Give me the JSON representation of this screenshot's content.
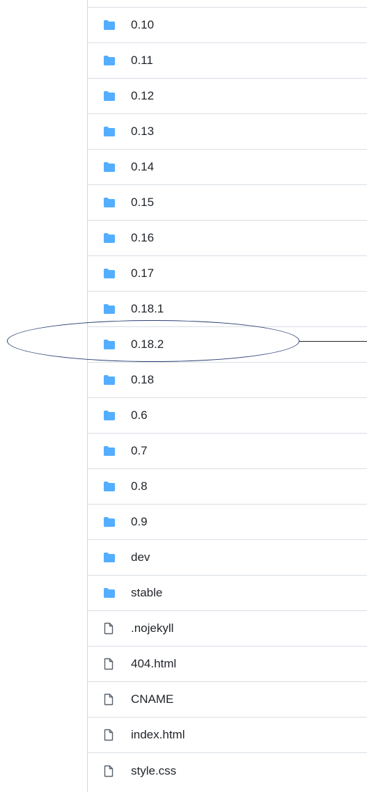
{
  "file_list": {
    "items": [
      {
        "name": "0.10",
        "type": "folder",
        "icon": "folder-icon"
      },
      {
        "name": "0.11",
        "type": "folder",
        "icon": "folder-icon"
      },
      {
        "name": "0.12",
        "type": "folder",
        "icon": "folder-icon"
      },
      {
        "name": "0.13",
        "type": "folder",
        "icon": "folder-icon"
      },
      {
        "name": "0.14",
        "type": "folder",
        "icon": "folder-icon"
      },
      {
        "name": "0.15",
        "type": "folder",
        "icon": "folder-icon"
      },
      {
        "name": "0.16",
        "type": "folder",
        "icon": "folder-icon"
      },
      {
        "name": "0.17",
        "type": "folder",
        "icon": "folder-icon"
      },
      {
        "name": "0.18.1",
        "type": "folder",
        "icon": "folder-icon"
      },
      {
        "name": "0.18.2",
        "type": "folder",
        "icon": "folder-icon",
        "highlighted": true
      },
      {
        "name": "0.18",
        "type": "folder",
        "icon": "folder-icon"
      },
      {
        "name": "0.6",
        "type": "folder",
        "icon": "folder-icon"
      },
      {
        "name": "0.7",
        "type": "folder",
        "icon": "folder-icon"
      },
      {
        "name": "0.8",
        "type": "folder",
        "icon": "folder-icon"
      },
      {
        "name": "0.9",
        "type": "folder",
        "icon": "folder-icon"
      },
      {
        "name": "dev",
        "type": "folder",
        "icon": "folder-icon"
      },
      {
        "name": "stable",
        "type": "folder",
        "icon": "folder-icon"
      },
      {
        "name": ".nojekyll",
        "type": "file",
        "icon": "file-icon"
      },
      {
        "name": "404.html",
        "type": "file",
        "icon": "file-icon"
      },
      {
        "name": "CNAME",
        "type": "file",
        "icon": "file-icon"
      },
      {
        "name": "index.html",
        "type": "file",
        "icon": "file-icon"
      },
      {
        "name": "style.css",
        "type": "file",
        "icon": "file-icon"
      }
    ]
  },
  "colors": {
    "folder_icon": "#54aeff",
    "file_icon": "#57606a",
    "text": "#1f2328",
    "row_border": "#d8dee4",
    "annotation_ellipse": "#2a3f73"
  }
}
